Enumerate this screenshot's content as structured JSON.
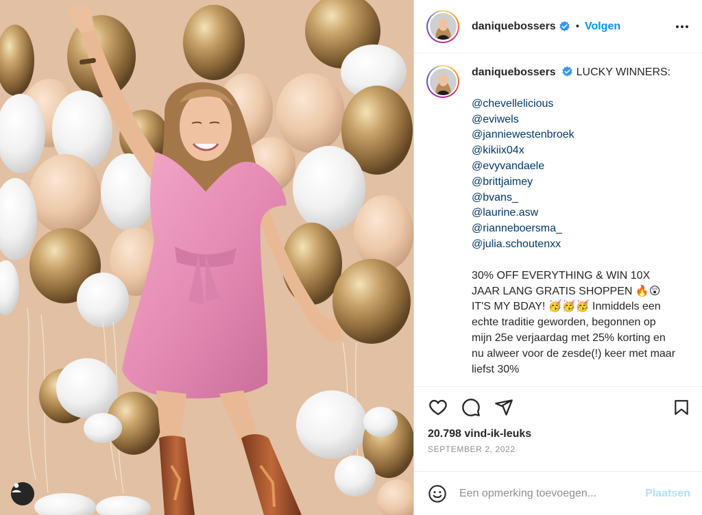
{
  "header": {
    "username": "daniquebossers",
    "separator": "•",
    "follow_label": "Volgen",
    "more_icon": "more-horizontal-icon"
  },
  "caption": {
    "username": "daniquebossers",
    "lead": "LUCKY WINNERS:",
    "mentions": [
      "@chevellelicious",
      "@eviwels",
      "@janniewestenbroek",
      "@kikiix04x",
      "@evyvandaele",
      "@brittjaimey",
      "@bvans_",
      "@laurine.asw",
      "@rianneboersma_",
      "@julia.schoutenxx"
    ],
    "body": "30% OFF EVERYTHING & WIN 10X JAAR LANG GRATIS SHOPPEN 🔥😲 IT'S MY BDAY! 🥳🥳🥳 Inmiddels een echte traditie geworden, begonnen op mijn 25e verjaardag met 25% korting en nu alweer voor de zesde(!) keer met maar liefst 30%"
  },
  "actions": {
    "like_icon": "heart-icon",
    "comment_icon": "comment-icon",
    "share_icon": "share-icon",
    "save_icon": "bookmark-icon"
  },
  "likes_text": "20.798 vind-ik-leuks",
  "date_text": "SEPTEMBER 2, 2022",
  "comment": {
    "emoji_icon": "emoji-icon",
    "placeholder": "Een opmerking toevoegen...",
    "post_label": "Plaatsen"
  },
  "colors": {
    "accent": "#0095f6",
    "link": "#00376b",
    "post_disabled": "#b2dffc",
    "photo_backdrop": "#e8c9ad",
    "dress_pink": "#e58cb4"
  }
}
